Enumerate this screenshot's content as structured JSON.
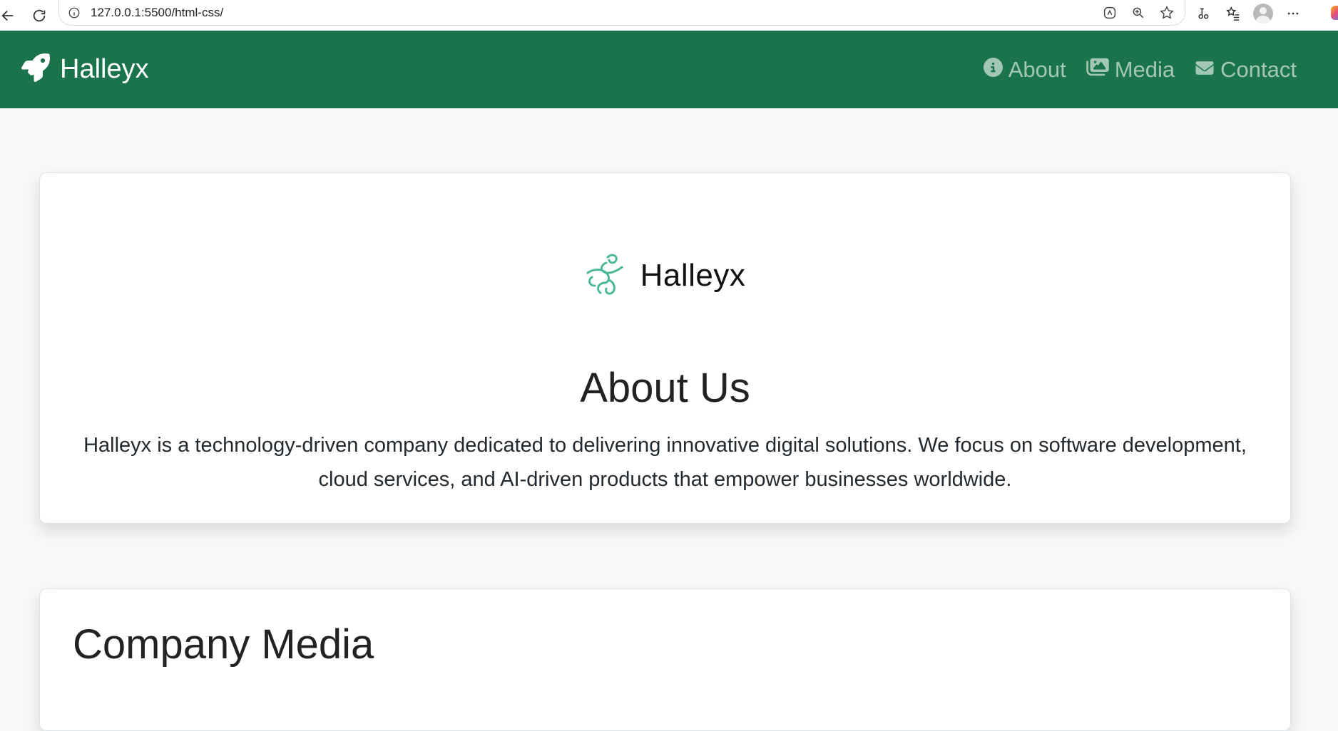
{
  "browser": {
    "url": "127.0.0.1:5500/html-css/",
    "icons": [
      "back-arrow-icon",
      "reload-icon",
      "info-icon",
      "copilot-icon",
      "zoom-icon",
      "favorite-star-icon",
      "read-aloud-icon",
      "favorites-list-icon",
      "profile-avatar",
      "more-icon"
    ]
  },
  "navbar": {
    "brand": "Halleyx",
    "brand_icon": "rocket-icon",
    "links": [
      {
        "label": "About",
        "icon": "info-circle-icon"
      },
      {
        "label": "Media",
        "icon": "images-icon"
      },
      {
        "label": "Contact",
        "icon": "envelope-icon"
      }
    ],
    "background": "#1b734b"
  },
  "about": {
    "logo_text": "Halleyx",
    "logo_color": "#4cb89a",
    "title": "About Us",
    "text": "Halleyx is a technology-driven company dedicated to delivering innovative digital solutions. We focus on software development, cloud services, and AI-driven products that empower businesses worldwide."
  },
  "media": {
    "title": "Company Media"
  }
}
